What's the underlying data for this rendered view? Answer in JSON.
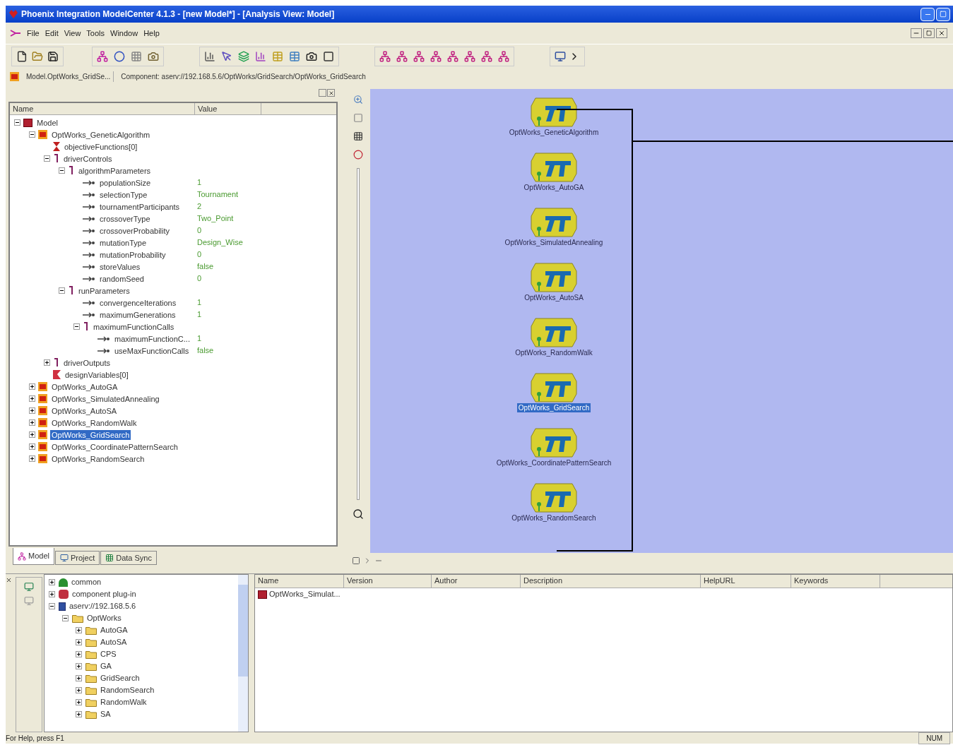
{
  "window": {
    "title": "Phoenix Integration ModelCenter 4.1.3 - [new Model*] - [Analysis View: Model]"
  },
  "menu": [
    "File",
    "Edit",
    "View",
    "Tools",
    "Window",
    "Help"
  ],
  "breadcrumb": {
    "model": "Model.OptWorks_GridSe...",
    "component": "Component: aserv://192.168.5.6/OptWorks/GridSearch/OptWorks_GridSearch"
  },
  "model_tree": {
    "columns": [
      "Name",
      "Value"
    ],
    "items": [
      {
        "name": "Model",
        "kind": "model",
        "expanded": true,
        "selected": false,
        "children": [
          {
            "name": "OptWorks_GeneticAlgorithm",
            "kind": "component",
            "expanded": true,
            "selected": false,
            "children": [
              {
                "name": "objectiveFunctions[0]",
                "kind": "objective",
                "selected": false
              },
              {
                "name": "driverControls",
                "kind": "group",
                "expanded": true,
                "selected": false,
                "children": [
                  {
                    "name": "algorithmParameters",
                    "kind": "group",
                    "expanded": true,
                    "selected": false,
                    "children": [
                      {
                        "name": "populationSize",
                        "kind": "variable",
                        "value": "1",
                        "selected": false
                      },
                      {
                        "name": "selectionType",
                        "kind": "variable",
                        "value": "Tournament",
                        "selected": false
                      },
                      {
                        "name": "tournamentParticipants",
                        "kind": "variable",
                        "value": "2",
                        "selected": false
                      },
                      {
                        "name": "crossoverType",
                        "kind": "variable",
                        "value": "Two_Point",
                        "selected": false
                      },
                      {
                        "name": "crossoverProbability",
                        "kind": "variable",
                        "value": "0",
                        "selected": false
                      },
                      {
                        "name": "mutationType",
                        "kind": "variable",
                        "value": "Design_Wise",
                        "selected": false
                      },
                      {
                        "name": "mutationProbability",
                        "kind": "variable",
                        "value": "0",
                        "selected": false
                      },
                      {
                        "name": "storeValues",
                        "kind": "variable",
                        "value": "false",
                        "selected": false
                      },
                      {
                        "name": "randomSeed",
                        "kind": "variable",
                        "value": "0",
                        "selected": false
                      }
                    ]
                  },
                  {
                    "name": "runParameters",
                    "kind": "group",
                    "expanded": true,
                    "selected": false,
                    "children": [
                      {
                        "name": "convergenceIterations",
                        "kind": "variable",
                        "value": "1",
                        "selected": false
                      },
                      {
                        "name": "maximumGenerations",
                        "kind": "variable",
                        "value": "1",
                        "selected": false
                      },
                      {
                        "name": "maximumFunctionCalls",
                        "kind": "group",
                        "expanded": true,
                        "selected": false,
                        "children": [
                          {
                            "name": "maximumFunctionC...",
                            "kind": "variable",
                            "value": "1",
                            "selected": false
                          },
                          {
                            "name": "useMaxFunctionCalls",
                            "kind": "variable",
                            "value": "false",
                            "selected": false
                          }
                        ]
                      }
                    ]
                  }
                ]
              },
              {
                "name": "driverOutputs",
                "kind": "group",
                "expanded": false,
                "selected": false
              },
              {
                "name": "designVariables[0]",
                "kind": "design",
                "selected": false
              }
            ]
          },
          {
            "name": "OptWorks_AutoGA",
            "kind": "component",
            "expanded": false,
            "selected": false
          },
          {
            "name": "OptWorks_SimulatedAnnealing",
            "kind": "component",
            "expanded": false,
            "selected": false
          },
          {
            "name": "OptWorks_AutoSA",
            "kind": "component",
            "expanded": false,
            "selected": false
          },
          {
            "name": "OptWorks_RandomWalk",
            "kind": "component",
            "expanded": false,
            "selected": false
          },
          {
            "name": "OptWorks_GridSearch",
            "kind": "component",
            "expanded": false,
            "selected": true
          },
          {
            "name": "OptWorks_CoordinatePatternSearch",
            "kind": "component",
            "expanded": false,
            "selected": false
          },
          {
            "name": "OptWorks_RandomSearch",
            "kind": "component",
            "expanded": false,
            "selected": false
          }
        ]
      }
    ]
  },
  "panel_tabs": [
    {
      "label": "Model",
      "selected": true
    },
    {
      "label": "Project",
      "selected": false
    },
    {
      "label": "Data Sync",
      "selected": false
    }
  ],
  "canvas": {
    "nodes": [
      {
        "label": "OptWorks_GeneticAlgorithm",
        "selected": false
      },
      {
        "label": "OptWorks_AutoGA",
        "selected": false
      },
      {
        "label": "OptWorks_SimulatedAnnealing",
        "selected": false
      },
      {
        "label": "OptWorks_AutoSA",
        "selected": false
      },
      {
        "label": "OptWorks_RandomWalk",
        "selected": false
      },
      {
        "label": "OptWorks_GridSearch",
        "selected": true
      },
      {
        "label": "OptWorks_CoordinatePatternSearch",
        "selected": false
      },
      {
        "label": "OptWorks_RandomSearch",
        "selected": false
      }
    ]
  },
  "server_tree": {
    "items": [
      {
        "name": "common",
        "kind": "library",
        "expanded": false
      },
      {
        "name": "component plug-in",
        "kind": "plugin",
        "expanded": false
      },
      {
        "name": "aserv://192.168.5.6",
        "kind": "server",
        "expanded": true,
        "children": [
          {
            "name": "OptWorks",
            "kind": "folder",
            "expanded": true,
            "children": [
              {
                "name": "AutoGA",
                "kind": "folder",
                "expanded": false
              },
              {
                "name": "AutoSA",
                "kind": "folder",
                "expanded": false
              },
              {
                "name": "CPS",
                "kind": "folder",
                "expanded": false
              },
              {
                "name": "GA",
                "kind": "folder",
                "expanded": false
              },
              {
                "name": "GridSearch",
                "kind": "folder",
                "expanded": false
              },
              {
                "name": "RandomSearch",
                "kind": "folder",
                "expanded": false
              },
              {
                "name": "RandomWalk",
                "kind": "folder",
                "expanded": false
              },
              {
                "name": "SA",
                "kind": "folder",
                "expanded": false
              }
            ]
          }
        ]
      }
    ]
  },
  "component_list": {
    "columns": [
      "Name",
      "Version",
      "Author",
      "Description",
      "HelpURL",
      "Keywords"
    ],
    "rows": [
      {
        "name": "OptWorks_Simulat..."
      }
    ]
  },
  "status_bar": {
    "message": "For Help, press F1",
    "indicator": "NUM"
  }
}
